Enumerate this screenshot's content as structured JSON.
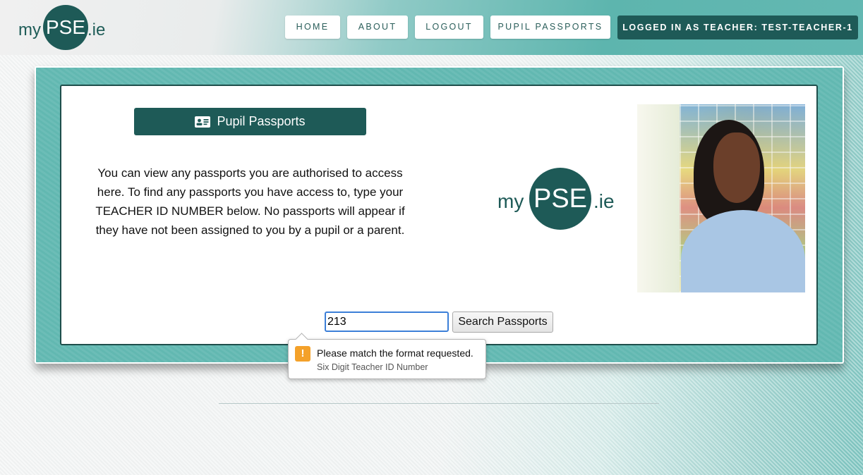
{
  "logo": {
    "left": "my",
    "center": "PSE",
    "right": ".ie"
  },
  "nav": {
    "home": "HOME",
    "about": "ABOUT",
    "logout": "LOGOUT",
    "pupil_passports": "PUPIL PASSPORTS",
    "logged_in": "LOGGED IN AS TEACHER: TEST-TEACHER-1"
  },
  "main": {
    "header": "Pupil Passports",
    "description": "You can view any passports you are authorised to access here. To find any passports you have access to, type your TEACHER ID NUMBER below. No passports will appear if they have not been assigned to you by a pupil or a parent.",
    "logo": {
      "left": "my",
      "center": "PSE",
      "right": ".ie"
    }
  },
  "search": {
    "value": "213",
    "button": "Search Passports"
  },
  "validation": {
    "message": "Please match the format requested.",
    "hint": "Six Digit Teacher ID Number"
  },
  "colors": {
    "brand_dark": "#1e5a57",
    "teal": "#62b8b1",
    "focus_blue": "#3c7fd8",
    "warning": "#f4a12a"
  }
}
